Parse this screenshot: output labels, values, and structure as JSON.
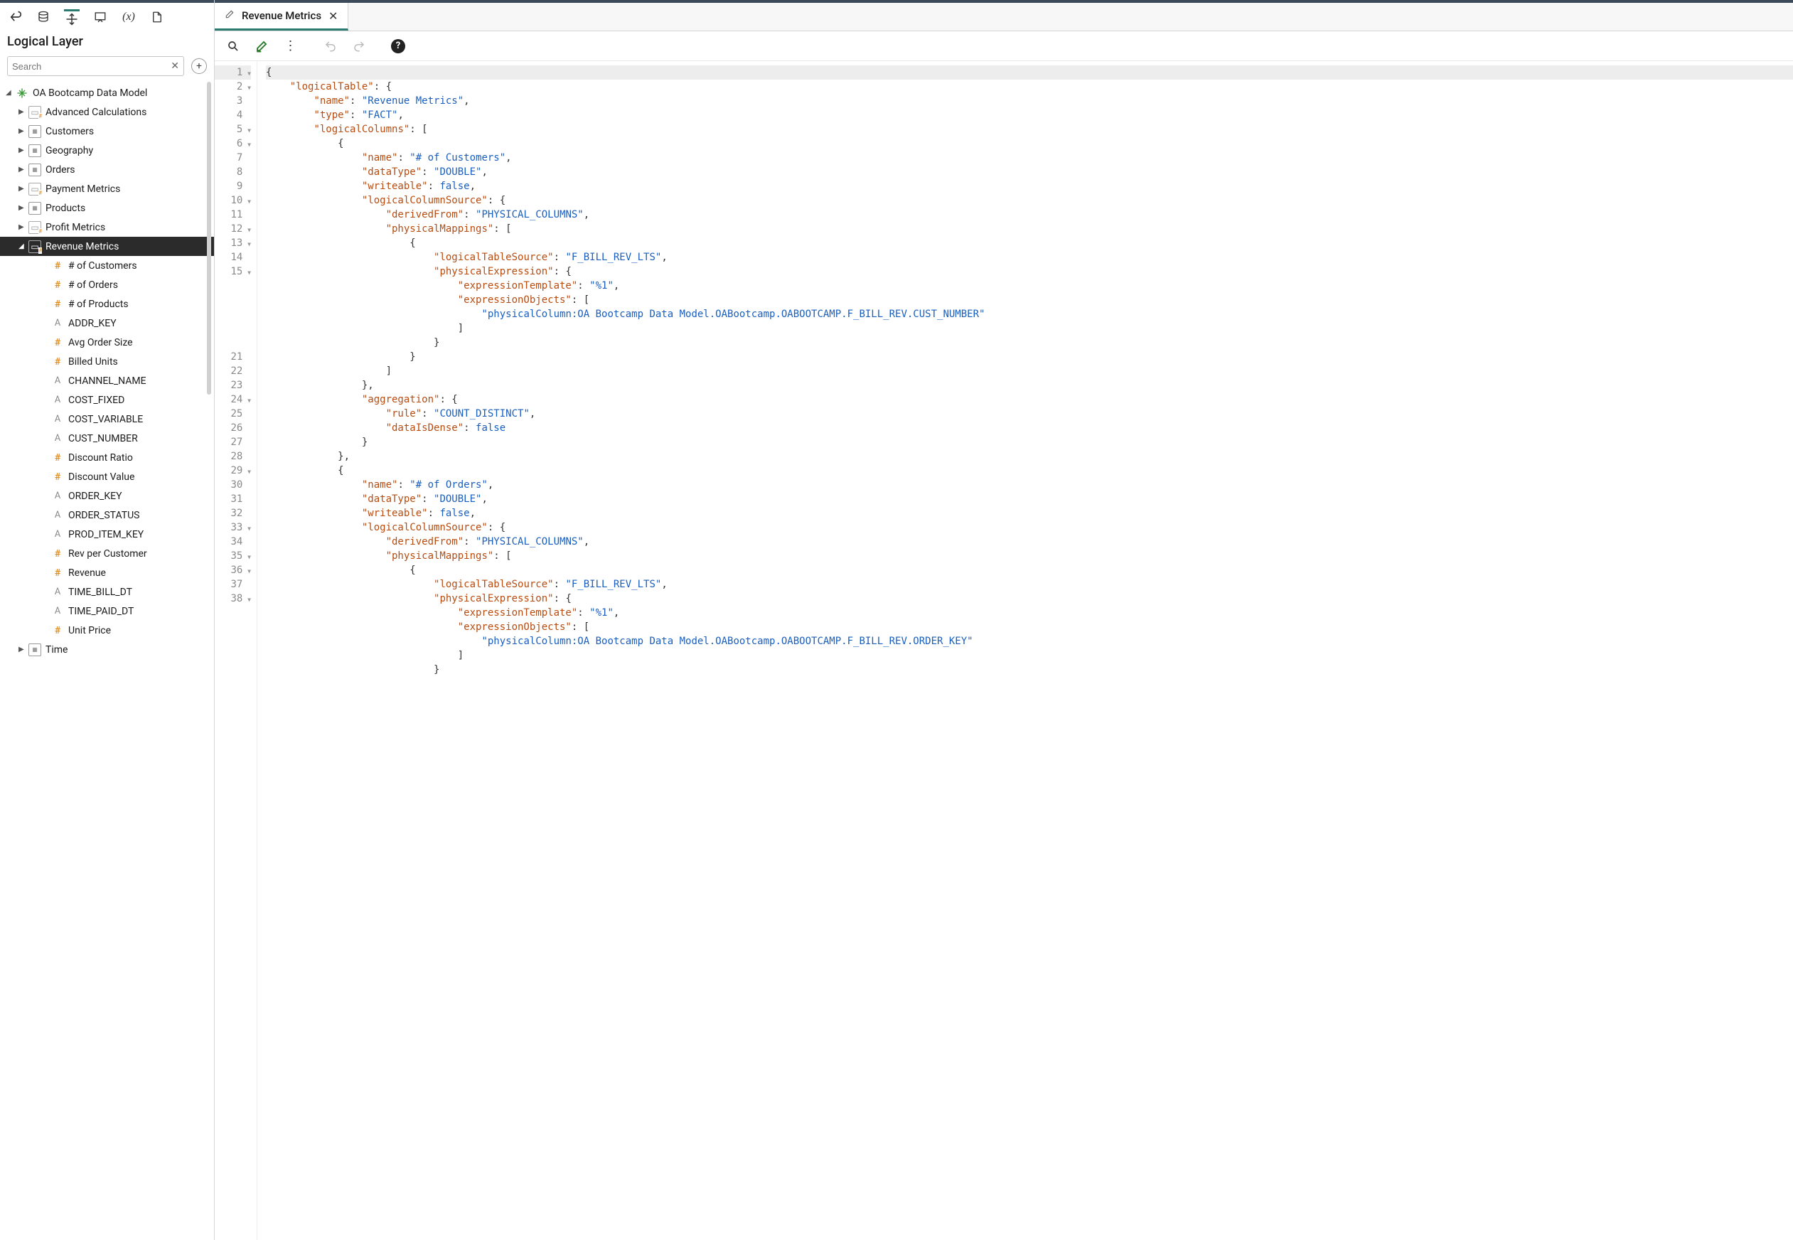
{
  "sidebar": {
    "title": "Logical Layer",
    "search_placeholder": "Search",
    "root": "OA Bootcamp Data Model",
    "folders": [
      {
        "label": "Advanced Calculations",
        "icon": "metrics"
      },
      {
        "label": "Customers",
        "icon": "table"
      },
      {
        "label": "Geography",
        "icon": "table"
      },
      {
        "label": "Orders",
        "icon": "table"
      },
      {
        "label": "Payment Metrics",
        "icon": "metrics"
      },
      {
        "label": "Products",
        "icon": "table"
      },
      {
        "label": "Profit Metrics",
        "icon": "metrics"
      },
      {
        "label": "Revenue Metrics",
        "icon": "metrics",
        "selected": true,
        "expanded": true
      }
    ],
    "revenue_children": [
      {
        "label": "# of Customers",
        "icon": "hash"
      },
      {
        "label": "# of Orders",
        "icon": "hash"
      },
      {
        "label": "# of Products",
        "icon": "hash"
      },
      {
        "label": "ADDR_KEY",
        "icon": "acol"
      },
      {
        "label": "Avg Order Size",
        "icon": "hash"
      },
      {
        "label": "Billed Units",
        "icon": "hash"
      },
      {
        "label": "CHANNEL_NAME",
        "icon": "acol"
      },
      {
        "label": "COST_FIXED",
        "icon": "acol"
      },
      {
        "label": "COST_VARIABLE",
        "icon": "acol"
      },
      {
        "label": "CUST_NUMBER",
        "icon": "acol"
      },
      {
        "label": "Discount Ratio",
        "icon": "hash"
      },
      {
        "label": "Discount Value",
        "icon": "hash"
      },
      {
        "label": "ORDER_KEY",
        "icon": "acol"
      },
      {
        "label": "ORDER_STATUS",
        "icon": "acol"
      },
      {
        "label": "PROD_ITEM_KEY",
        "icon": "acol"
      },
      {
        "label": "Rev per Customer",
        "icon": "hash"
      },
      {
        "label": "Revenue",
        "icon": "hash"
      },
      {
        "label": "TIME_BILL_DT",
        "icon": "acol"
      },
      {
        "label": "TIME_PAID_DT",
        "icon": "acol"
      },
      {
        "label": "Unit Price",
        "icon": "hash"
      }
    ],
    "trailing_folder": {
      "label": "Time",
      "icon": "table"
    }
  },
  "tab": {
    "label": "Revenue Metrics"
  },
  "code": {
    "gutter": [
      {
        "n": "1",
        "fold": true
      },
      {
        "n": "2",
        "fold": true
      },
      {
        "n": "3"
      },
      {
        "n": "4"
      },
      {
        "n": "5",
        "fold": true
      },
      {
        "n": "6",
        "fold": true
      },
      {
        "n": "7"
      },
      {
        "n": "8"
      },
      {
        "n": "9"
      },
      {
        "n": "10",
        "fold": true
      },
      {
        "n": "11"
      },
      {
        "n": "12",
        "fold": true
      },
      {
        "n": "13",
        "fold": true
      },
      {
        "n": "14"
      },
      {
        "n": "15",
        "fold": true
      },
      {
        "n": ""
      },
      {
        "n": ""
      },
      {
        "n": ""
      },
      {
        "n": ""
      },
      {
        "n": ""
      },
      {
        "n": "21"
      },
      {
        "n": "22"
      },
      {
        "n": "23"
      },
      {
        "n": "24",
        "fold": true
      },
      {
        "n": "25"
      },
      {
        "n": "26"
      },
      {
        "n": "27"
      },
      {
        "n": "28"
      },
      {
        "n": "29",
        "fold": true
      },
      {
        "n": "30"
      },
      {
        "n": "31"
      },
      {
        "n": "32"
      },
      {
        "n": "33",
        "fold": true
      },
      {
        "n": "34"
      },
      {
        "n": "35",
        "fold": true
      },
      {
        "n": "36",
        "fold": true
      },
      {
        "n": "37"
      },
      {
        "n": "38",
        "fold": true
      },
      {
        "n": ""
      },
      {
        "n": ""
      },
      {
        "n": ""
      },
      {
        "n": ""
      },
      {
        "n": ""
      }
    ],
    "source": [
      [
        [
          "p",
          "{"
        ]
      ],
      [
        [
          "sp",
          "    "
        ],
        [
          "k",
          "\"logicalTable\""
        ],
        [
          "p",
          ": {"
        ]
      ],
      [
        [
          "sp",
          "        "
        ],
        [
          "k",
          "\"name\""
        ],
        [
          "p",
          ": "
        ],
        [
          "s",
          "\"Revenue Metrics\""
        ],
        [
          "p",
          ","
        ]
      ],
      [
        [
          "sp",
          "        "
        ],
        [
          "k",
          "\"type\""
        ],
        [
          "p",
          ": "
        ],
        [
          "s",
          "\"FACT\""
        ],
        [
          "p",
          ","
        ]
      ],
      [
        [
          "sp",
          "        "
        ],
        [
          "k",
          "\"logicalColumns\""
        ],
        [
          "p",
          ": ["
        ]
      ],
      [
        [
          "sp",
          "            "
        ],
        [
          "p",
          "{"
        ]
      ],
      [
        [
          "sp",
          "                "
        ],
        [
          "k",
          "\"name\""
        ],
        [
          "p",
          ": "
        ],
        [
          "s",
          "\"# of Customers\""
        ],
        [
          "p",
          ","
        ]
      ],
      [
        [
          "sp",
          "                "
        ],
        [
          "k",
          "\"dataType\""
        ],
        [
          "p",
          ": "
        ],
        [
          "s",
          "\"DOUBLE\""
        ],
        [
          "p",
          ","
        ]
      ],
      [
        [
          "sp",
          "                "
        ],
        [
          "k",
          "\"writeable\""
        ],
        [
          "p",
          ": "
        ],
        [
          "b",
          "false"
        ],
        [
          "p",
          ","
        ]
      ],
      [
        [
          "sp",
          "                "
        ],
        [
          "k",
          "\"logicalColumnSource\""
        ],
        [
          "p",
          ": {"
        ]
      ],
      [
        [
          "sp",
          "                    "
        ],
        [
          "k",
          "\"derivedFrom\""
        ],
        [
          "p",
          ": "
        ],
        [
          "s",
          "\"PHYSICAL_COLUMNS\""
        ],
        [
          "p",
          ","
        ]
      ],
      [
        [
          "sp",
          "                    "
        ],
        [
          "k",
          "\"physicalMappings\""
        ],
        [
          "p",
          ": ["
        ]
      ],
      [
        [
          "sp",
          "                        "
        ],
        [
          "p",
          "{"
        ]
      ],
      [
        [
          "sp",
          "                            "
        ],
        [
          "k",
          "\"logicalTableSource\""
        ],
        [
          "p",
          ": "
        ],
        [
          "s",
          "\"F_BILL_REV_LTS\""
        ],
        [
          "p",
          ","
        ]
      ],
      [
        [
          "sp",
          "                            "
        ],
        [
          "k",
          "\"physicalExpression\""
        ],
        [
          "p",
          ": {"
        ]
      ],
      [
        [
          "sp",
          "                                "
        ],
        [
          "k",
          "\"expressionTemplate\""
        ],
        [
          "p",
          ": "
        ],
        [
          "s",
          "\"%1\""
        ],
        [
          "p",
          ","
        ]
      ],
      [
        [
          "sp",
          "                                "
        ],
        [
          "k",
          "\"expressionObjects\""
        ],
        [
          "p",
          ": ["
        ]
      ],
      [
        [
          "sp",
          "                                    "
        ],
        [
          "s",
          "\"physicalColumn:OA Bootcamp Data Model.OABootcamp.OABOOTCAMP.F_BILL_REV.CUST_NUMBER\""
        ]
      ],
      [
        [
          "sp",
          "                                "
        ],
        [
          "p",
          "]"
        ]
      ],
      [
        [
          "sp",
          "                            "
        ],
        [
          "p",
          "}"
        ]
      ],
      [
        [
          "sp",
          "                        "
        ],
        [
          "p",
          "}"
        ]
      ],
      [
        [
          "sp",
          "                    "
        ],
        [
          "p",
          "]"
        ]
      ],
      [
        [
          "sp",
          "                "
        ],
        [
          "p",
          "},"
        ]
      ],
      [
        [
          "sp",
          "                "
        ],
        [
          "k",
          "\"aggregation\""
        ],
        [
          "p",
          ": {"
        ]
      ],
      [
        [
          "sp",
          "                    "
        ],
        [
          "k",
          "\"rule\""
        ],
        [
          "p",
          ": "
        ],
        [
          "s",
          "\"COUNT_DISTINCT\""
        ],
        [
          "p",
          ","
        ]
      ],
      [
        [
          "sp",
          "                    "
        ],
        [
          "k",
          "\"dataIsDense\""
        ],
        [
          "p",
          ": "
        ],
        [
          "b",
          "false"
        ]
      ],
      [
        [
          "sp",
          "                "
        ],
        [
          "p",
          "}"
        ]
      ],
      [
        [
          "sp",
          "            "
        ],
        [
          "p",
          "},"
        ]
      ],
      [
        [
          "sp",
          "            "
        ],
        [
          "p",
          "{"
        ]
      ],
      [
        [
          "sp",
          "                "
        ],
        [
          "k",
          "\"name\""
        ],
        [
          "p",
          ": "
        ],
        [
          "s",
          "\"# of Orders\""
        ],
        [
          "p",
          ","
        ]
      ],
      [
        [
          "sp",
          "                "
        ],
        [
          "k",
          "\"dataType\""
        ],
        [
          "p",
          ": "
        ],
        [
          "s",
          "\"DOUBLE\""
        ],
        [
          "p",
          ","
        ]
      ],
      [
        [
          "sp",
          "                "
        ],
        [
          "k",
          "\"writeable\""
        ],
        [
          "p",
          ": "
        ],
        [
          "b",
          "false"
        ],
        [
          "p",
          ","
        ]
      ],
      [
        [
          "sp",
          "                "
        ],
        [
          "k",
          "\"logicalColumnSource\""
        ],
        [
          "p",
          ": {"
        ]
      ],
      [
        [
          "sp",
          "                    "
        ],
        [
          "k",
          "\"derivedFrom\""
        ],
        [
          "p",
          ": "
        ],
        [
          "s",
          "\"PHYSICAL_COLUMNS\""
        ],
        [
          "p",
          ","
        ]
      ],
      [
        [
          "sp",
          "                    "
        ],
        [
          "k",
          "\"physicalMappings\""
        ],
        [
          "p",
          ": ["
        ]
      ],
      [
        [
          "sp",
          "                        "
        ],
        [
          "p",
          "{"
        ]
      ],
      [
        [
          "sp",
          "                            "
        ],
        [
          "k",
          "\"logicalTableSource\""
        ],
        [
          "p",
          ": "
        ],
        [
          "s",
          "\"F_BILL_REV_LTS\""
        ],
        [
          "p",
          ","
        ]
      ],
      [
        [
          "sp",
          "                            "
        ],
        [
          "k",
          "\"physicalExpression\""
        ],
        [
          "p",
          ": {"
        ]
      ],
      [
        [
          "sp",
          "                                "
        ],
        [
          "k",
          "\"expressionTemplate\""
        ],
        [
          "p",
          ": "
        ],
        [
          "s",
          "\"%1\""
        ],
        [
          "p",
          ","
        ]
      ],
      [
        [
          "sp",
          "                                "
        ],
        [
          "k",
          "\"expressionObjects\""
        ],
        [
          "p",
          ": ["
        ]
      ],
      [
        [
          "sp",
          "                                    "
        ],
        [
          "s",
          "\"physicalColumn:OA Bootcamp Data Model.OABootcamp.OABOOTCAMP.F_BILL_REV.ORDER_KEY\""
        ]
      ],
      [
        [
          "sp",
          "                                "
        ],
        [
          "p",
          "]"
        ]
      ],
      [
        [
          "sp",
          "                            "
        ],
        [
          "p",
          "}"
        ]
      ]
    ]
  }
}
